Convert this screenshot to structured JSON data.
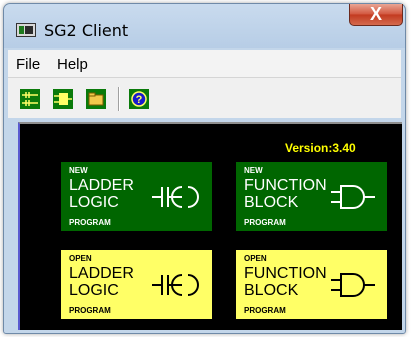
{
  "window": {
    "title": "SG2 Client",
    "close_glyph": "X"
  },
  "menu": {
    "file": "File",
    "help": "Help"
  },
  "toolbar": {
    "buttons": [
      "ladder-logic-icon",
      "function-block-icon",
      "open-folder-icon",
      "help-icon"
    ]
  },
  "canvas": {
    "version": "Version:3.40",
    "panels": [
      {
        "kind": "NEW",
        "line1": "LADDER",
        "line2": "LOGIC",
        "program": "PROGRAM",
        "symbol": "ladder-contact-icon"
      },
      {
        "kind": "NEW",
        "line1": "FUNCTION",
        "line2": "BLOCK",
        "program": "PROGRAM",
        "symbol": "and-gate-icon"
      },
      {
        "kind": "OPEN",
        "line1": "LADDER",
        "line2": "LOGIC",
        "program": "PROGRAM",
        "symbol": "ladder-contact-icon"
      },
      {
        "kind": "OPEN",
        "line1": "FUNCTION",
        "line2": "BLOCK",
        "program": "PROGRAM",
        "symbol": "and-gate-icon"
      }
    ]
  },
  "colors": {
    "new_panel": "#006600",
    "open_panel": "#ffff66",
    "version_text": "#ffff00",
    "canvas_bg": "#000000"
  }
}
